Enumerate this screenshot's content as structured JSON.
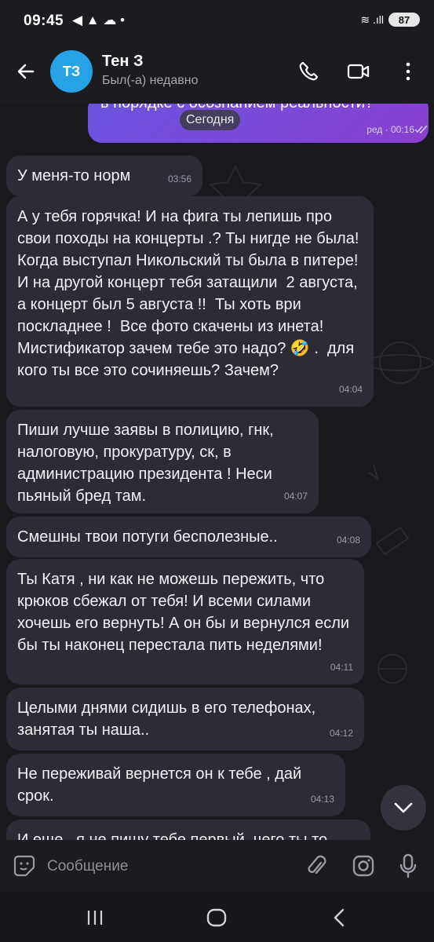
{
  "status_bar": {
    "time": "09:45",
    "left_icons": "◀ ▲ ☁ •",
    "signal_icons": "≋ .ıll",
    "battery": "87"
  },
  "header": {
    "avatar_initials": "ТЗ",
    "name": "Тен З",
    "status": "Был(-а) недавно"
  },
  "chat": {
    "date_chip": "Сегодня",
    "outgoing_partial": {
      "text": "в порядке с осознанием реальности?",
      "meta": "ред · 00:16"
    },
    "messages": [
      {
        "text": "У меня-то норм",
        "time": "03:56"
      },
      {
        "text": "А у тебя горячка! И на фига ты лепишь про свои походы на концерты .? Ты нигде не была! Когда выступал Никольский ты была в питере! И на другой концерт тебя затащили  2 августа, а концерт был 5 августа !!  Ты хоть ври поскладнее !  Все фото скачены из инета!  Мистификатор зачем тебе это надо? 🤣 .  для кого ты все это сочиняешь? Зачем?",
        "time": "04:04"
      },
      {
        "text": "Пиши лучше заявы в полицию, гнк, налоговую, прокуратуру, ск, в администрацию президента ! Неси пьяный бред там.",
        "time": "04:07"
      },
      {
        "text": "Смешны твои потуги бесполезные..",
        "time": "04:08"
      },
      {
        "text": "Ты Катя , ни как не можешь пережить, что крюков сбежал от тебя! И всеми силами хочешь его вернуть! А он бы и вернулся если бы ты наконец перестала пить неделями!",
        "time": "04:11"
      },
      {
        "text": "Целыми днями сидишь в его телефонах, занятая ты наша..",
        "time": "04:12"
      },
      {
        "text": "Не переживай вернется он к тебе , дай срок.",
        "time": "04:13"
      },
      {
        "text": "И еще , я не пишу тебе первый, чего ты то",
        "time": ""
      }
    ]
  },
  "input_bar": {
    "placeholder": "Сообщение"
  },
  "colors": {
    "background": "#1a1a1e",
    "incoming_bubble": "#2c2c37",
    "outgoing_bubble": "#7a4ad8",
    "avatar": "#28a2e6"
  }
}
